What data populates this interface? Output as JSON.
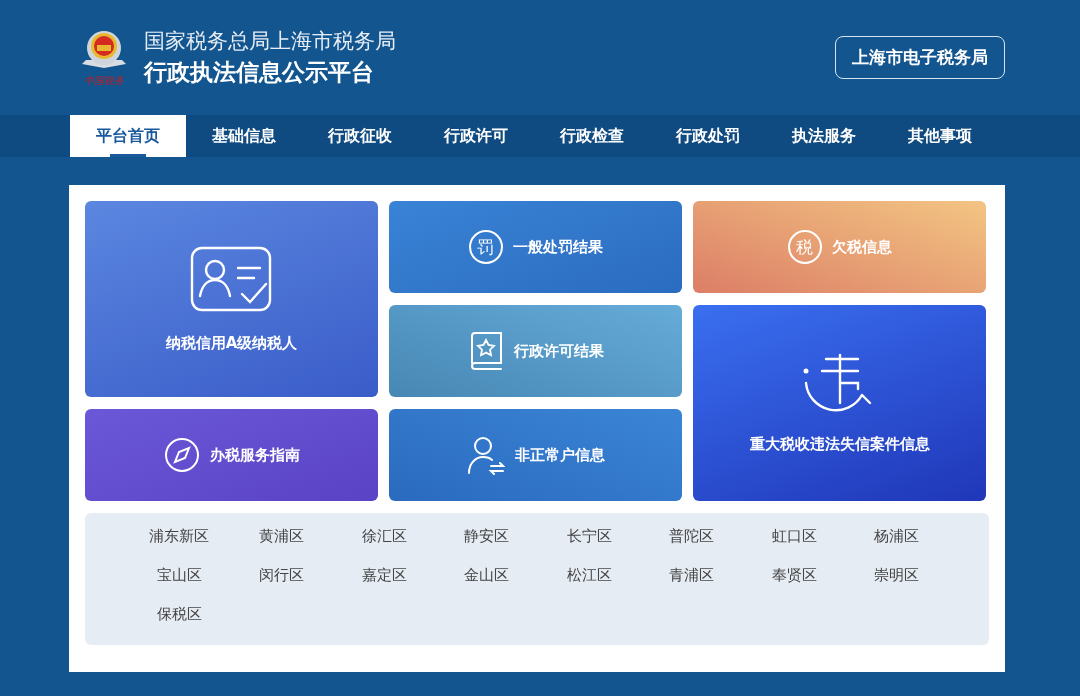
{
  "header": {
    "logo_text": "中国税务",
    "title": "国家税务总局上海市税务局",
    "subtitle": "行政执法信息公示平台",
    "link": "上海市电子税务局"
  },
  "nav": [
    {
      "label": "平台首页",
      "selected": true
    },
    {
      "label": "基础信息",
      "selected": false
    },
    {
      "label": "行政征收",
      "selected": false
    },
    {
      "label": "行政许可",
      "selected": false
    },
    {
      "label": "行政检查",
      "selected": false
    },
    {
      "label": "行政处罚",
      "selected": false
    },
    {
      "label": "执法服务",
      "selected": false
    },
    {
      "label": "其他事项",
      "selected": false
    }
  ],
  "tiles": [
    {
      "label": "纳税信用A级纳税人",
      "kind": "idcard"
    },
    {
      "label": "一般处罚结果",
      "kind": "glyph",
      "glyph": "罚"
    },
    {
      "label": "欠税信息",
      "kind": "glyph",
      "glyph": "税"
    },
    {
      "label": "行政许可结果",
      "kind": "book"
    },
    {
      "label": "重大税收违法失信案件信息",
      "kind": "violation"
    },
    {
      "label": "办税服务指南",
      "kind": "compass"
    },
    {
      "label": "非正常户信息",
      "kind": "user"
    }
  ],
  "districts": [
    "浦东新区",
    "黄浦区",
    "徐汇区",
    "静安区",
    "长宁区",
    "普陀区",
    "虹口区",
    "杨浦区",
    "宝山区",
    "闵行区",
    "嘉定区",
    "金山区",
    "松江区",
    "青浦区",
    "奉贤区",
    "崇明区",
    "保税区"
  ]
}
